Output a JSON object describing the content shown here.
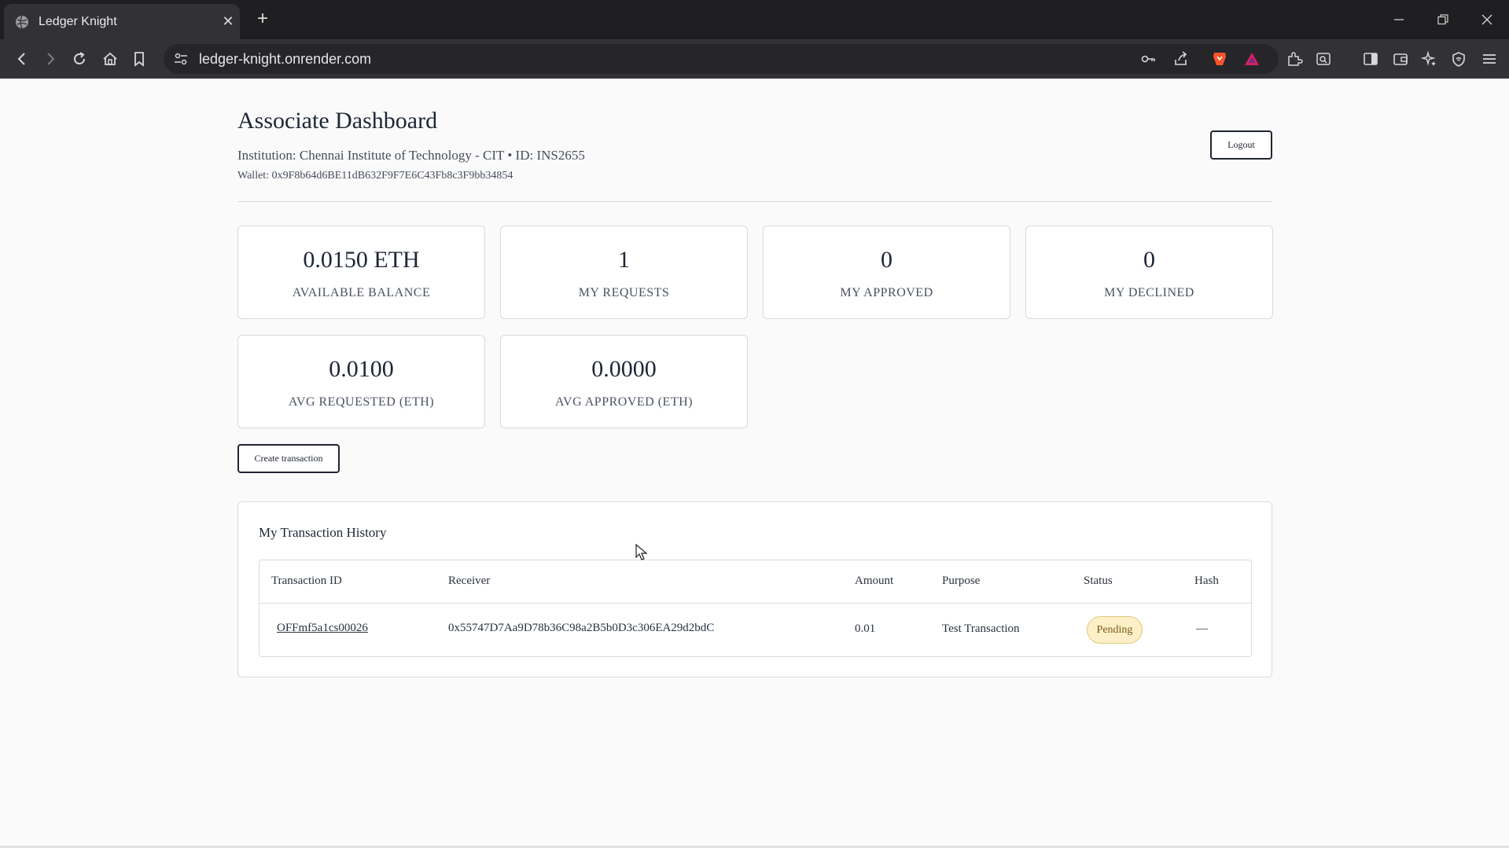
{
  "browser": {
    "tab_title": "Ledger Knight",
    "tab_close": "✕",
    "new_tab": "+",
    "url": "ledger-knight.onrender.com",
    "icons": [
      "back-icon",
      "forward-icon",
      "reload-icon",
      "home-icon",
      "bookmark-icon",
      "site-settings-icon",
      "password-key-icon",
      "share-icon",
      "brave-shields-icon",
      "brave-rewards-icon",
      "extensions-icon",
      "tab-search-icon",
      "sidebar-icon",
      "wallet-icon",
      "leo-ai-icon",
      "vpn-icon",
      "menu-icon"
    ]
  },
  "header": {
    "title": "Associate Dashboard",
    "institution": "Institution: Chennai Institute of Technology - CIT • ID: INS2655",
    "wallet": "Wallet: 0x9F8b64d6BE11dB632F9F7E6C43Fb8c3F9bb34854",
    "logout_label": "Logout"
  },
  "stats": [
    {
      "value": "0.0150 ETH",
      "label": "AVAILABLE BALANCE"
    },
    {
      "value": "1",
      "label": "MY REQUESTS"
    },
    {
      "value": "0",
      "label": "MY APPROVED"
    },
    {
      "value": "0",
      "label": "MY DECLINED"
    },
    {
      "value": "0.0100",
      "label": "AVG REQUESTED (ETH)"
    },
    {
      "value": "0.0000",
      "label": "AVG APPROVED (ETH)"
    }
  ],
  "create_label": "Create transaction",
  "history": {
    "title": "My Transaction History",
    "columns": [
      "Transaction ID",
      "Receiver",
      "Amount",
      "Purpose",
      "Status",
      "Hash"
    ],
    "rows": [
      {
        "id": "OFFmf5a1cs00026",
        "receiver": "0x55747D7Aa9D78b36C98a2B5b0D3c306EA29d2bdC",
        "amount": "0.01",
        "purpose": "Test Transaction",
        "status": "Pending",
        "hash": "—"
      }
    ]
  },
  "colors": {
    "chrome_dark": "#1f1f21",
    "toolbar": "#323236",
    "page_bg": "#fafafa",
    "pending_badge_bg": "#fdf0c8"
  }
}
